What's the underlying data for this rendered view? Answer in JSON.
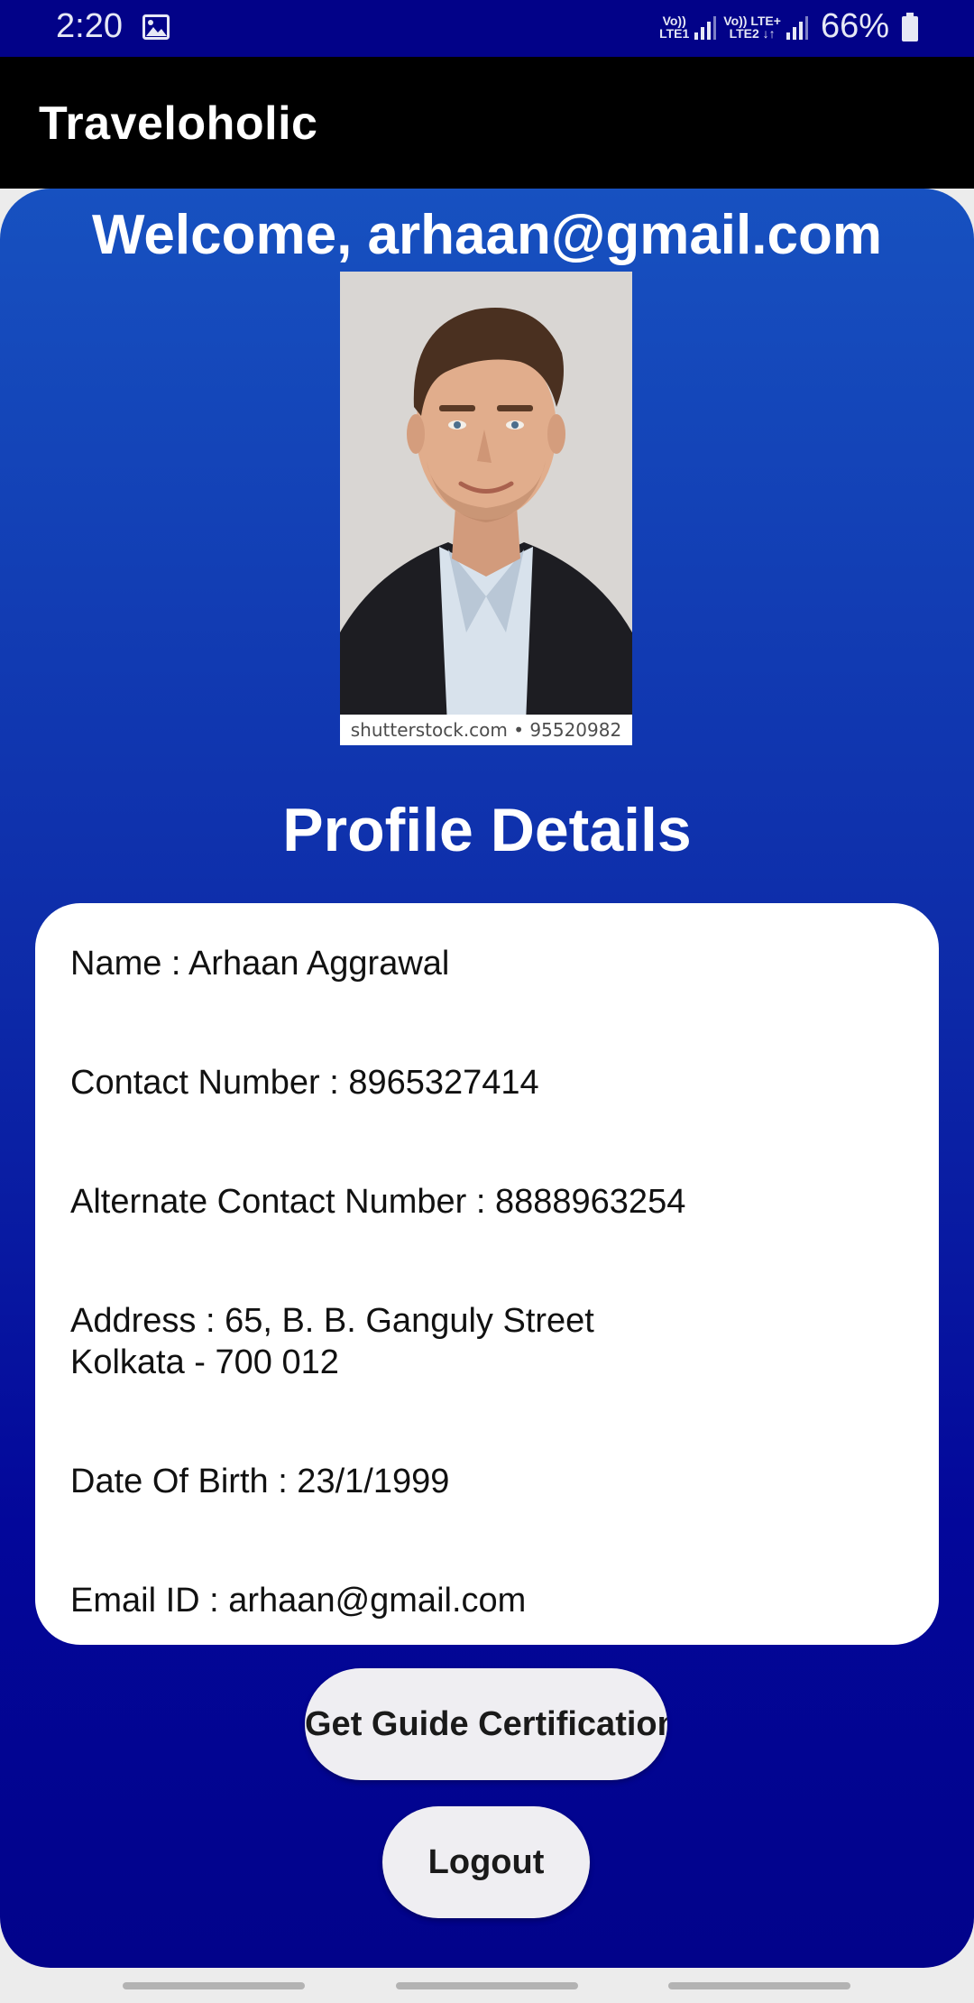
{
  "status_bar": {
    "time": "2:20",
    "sim1_label_top": "Vo))",
    "sim1_label_bottom": "LTE1",
    "sim2_label_top": "Vo)) LTE+",
    "sim2_label_bottom": "LTE2",
    "battery": "66%",
    "icons": [
      "gallery-icon",
      "signal-icon",
      "battery-icon"
    ]
  },
  "app_bar": {
    "title": "Traveloholic"
  },
  "main": {
    "welcome": "Welcome, arhaan@gmail.com",
    "photo_caption": "shutterstock.com • 95520982",
    "section_title": "Profile Details"
  },
  "details": {
    "name": "Name : Arhaan Aggrawal",
    "contact": "Contact Number : 8965327414",
    "alt_contact": "Alternate Contact Number : 8888963254",
    "address_line1": "Address : 65, B. B. Ganguly Street",
    "address_line2": "Kolkata - 700 012",
    "dob": "Date Of Birth : 23/1/1999",
    "email": "Email ID : arhaan@gmail.com"
  },
  "buttons": {
    "certification": "Get Guide Certification",
    "logout": "Logout"
  },
  "colors": {
    "status_bar": "#020288",
    "app_bar": "#000000",
    "gradient_top": "#1751c0",
    "gradient_bottom": "#02038a",
    "button_bg": "#efeef2"
  }
}
